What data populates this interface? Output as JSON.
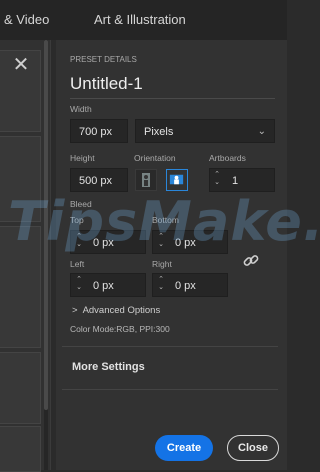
{
  "tabs": [
    "& Video",
    "Art & Illustration"
  ],
  "preset": {
    "section_label": "PRESET DETAILS",
    "name": "Untitled-1",
    "width_label": "Width",
    "width_value": "700 px",
    "units_value": "Pixels",
    "height_label": "Height",
    "height_value": "500 px",
    "orientation_label": "Orientation",
    "artboards_label": "Artboards",
    "artboards_value": "1",
    "bleed_label": "Bleed",
    "top_label": "Top",
    "bottom_label": "Bottom",
    "left_label": "Left",
    "right_label": "Right",
    "top_value": "0 px",
    "bottom_value": "0 px",
    "left_value": "0 px",
    "right_value": "0 px",
    "advanced_label": "Advanced Options",
    "color_mode_text": "Color Mode:RGB, PPI:300",
    "more_settings": "More Settings"
  },
  "buttons": {
    "create": "Create",
    "close": "Close"
  },
  "watermark_text": "TipsMake.com",
  "icons": {
    "close": "close-icon",
    "dropdown": "chevron-down-icon",
    "portrait": "portrait-icon",
    "landscape": "landscape-icon",
    "link": "link-icon",
    "spinner": "spinner-arrows-icon",
    "chevron_right": "chevron-right-icon"
  },
  "colors": {
    "accent": "#1473e6",
    "orientation_active": "#2a86d9",
    "background": "#2b2b2b"
  }
}
